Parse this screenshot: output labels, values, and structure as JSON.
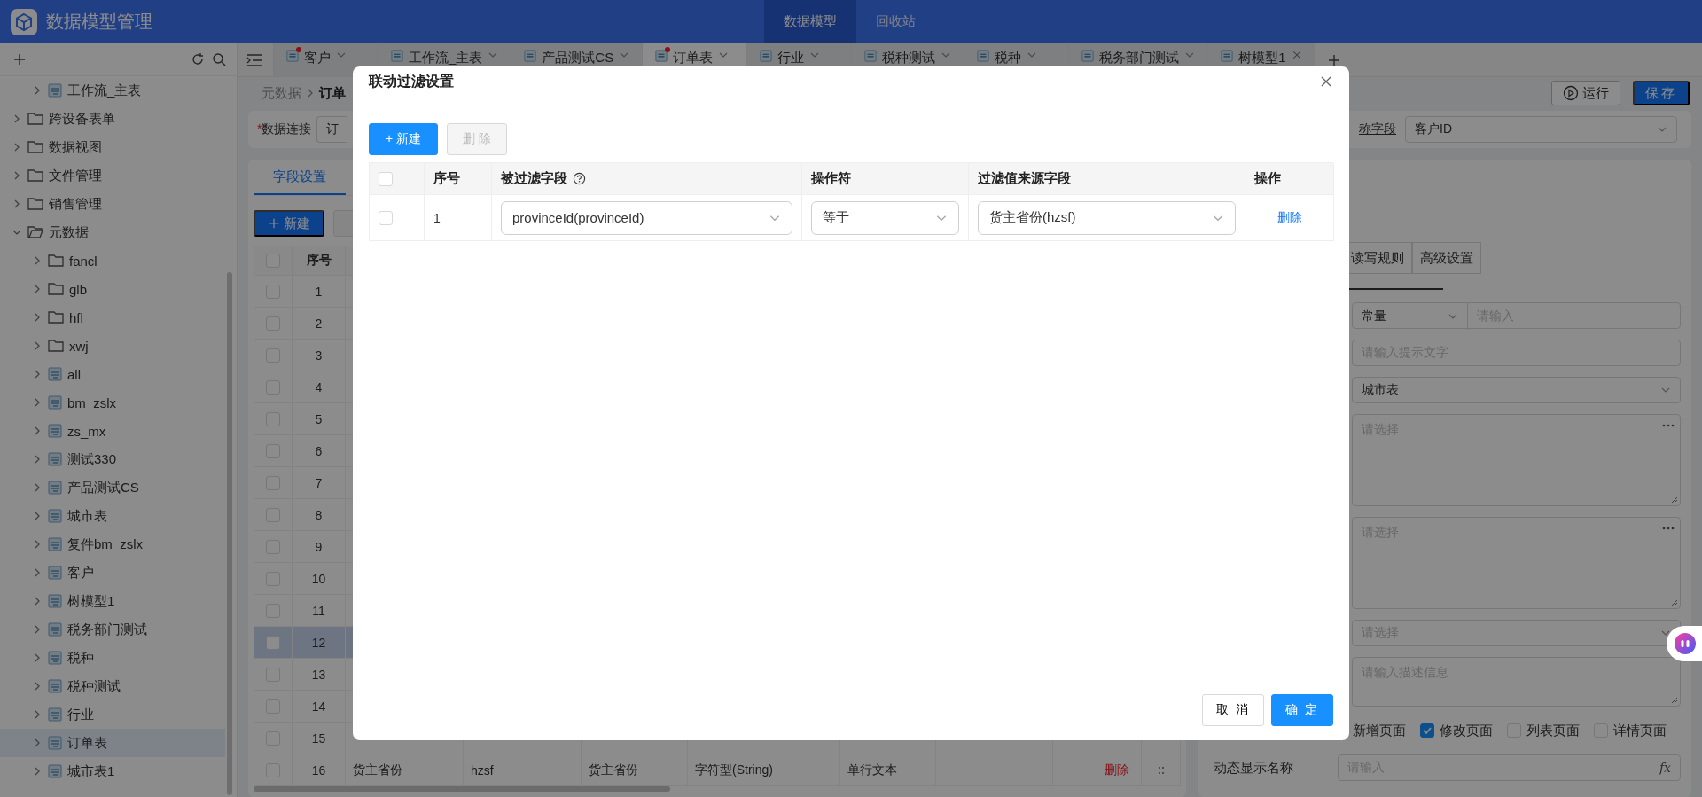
{
  "header": {
    "title": "数据模型管理",
    "nav": [
      {
        "label": "数据模型",
        "selected": true
      },
      {
        "label": "回收站",
        "selected": false
      }
    ]
  },
  "sidebar": {
    "tree_continued": [
      {
        "kind": "table",
        "label": "工作流_主表",
        "selected": false
      }
    ],
    "tree": [
      {
        "kind": "folder",
        "label": "跨设备表单",
        "expanded": false,
        "selected": false
      },
      {
        "kind": "folder",
        "label": "数据视图",
        "expanded": false,
        "selected": false
      },
      {
        "kind": "folder",
        "label": "文件管理",
        "expanded": false,
        "selected": false
      },
      {
        "kind": "folder",
        "label": "销售管理",
        "expanded": false,
        "selected": false
      },
      {
        "kind": "folder",
        "label": "元数据",
        "expanded": true,
        "selected": false,
        "children": [
          {
            "kind": "folder",
            "label": "fancl",
            "expanded": false,
            "selected": false
          },
          {
            "kind": "folder",
            "label": "glb",
            "expanded": false,
            "selected": false
          },
          {
            "kind": "folder",
            "label": "hfl",
            "expanded": false,
            "selected": false
          },
          {
            "kind": "folder",
            "label": "xwj",
            "expanded": false,
            "selected": false
          },
          {
            "kind": "table",
            "label": "all",
            "selected": false
          },
          {
            "kind": "table",
            "label": "bm_zslx",
            "selected": false
          },
          {
            "kind": "table",
            "label": "zs_mx",
            "selected": false
          },
          {
            "kind": "table",
            "label": "测试330",
            "selected": false
          },
          {
            "kind": "table",
            "label": "产品测试CS",
            "selected": false
          },
          {
            "kind": "table",
            "label": "城市表",
            "selected": false
          },
          {
            "kind": "table",
            "label": "复件bm_zslx",
            "selected": false
          },
          {
            "kind": "table",
            "label": "客户",
            "selected": false
          },
          {
            "kind": "table",
            "label": "树模型1",
            "selected": false
          },
          {
            "kind": "table",
            "label": "税务部门测试",
            "selected": false
          },
          {
            "kind": "table",
            "label": "税种",
            "selected": false
          },
          {
            "kind": "table",
            "label": "税种测试",
            "selected": false
          },
          {
            "kind": "table",
            "label": "行业",
            "selected": false
          },
          {
            "kind": "table",
            "label": "订单表",
            "selected": true
          },
          {
            "kind": "table",
            "label": "城市表1",
            "selected": false
          }
        ]
      }
    ]
  },
  "tabs": [
    {
      "label": "客户",
      "modified": true,
      "selected": false,
      "closable": false
    },
    {
      "label": "工作流_主表",
      "modified": false,
      "selected": false,
      "closable": false
    },
    {
      "label": "产品测试CS",
      "modified": false,
      "selected": false,
      "closable": false
    },
    {
      "label": "订单表",
      "modified": true,
      "selected": true,
      "closable": false
    },
    {
      "label": "行业",
      "modified": false,
      "selected": false,
      "closable": false
    },
    {
      "label": "税种测试",
      "modified": false,
      "selected": false,
      "closable": false
    },
    {
      "label": "税种",
      "modified": false,
      "selected": false,
      "closable": false
    },
    {
      "label": "税务部门测试",
      "modified": false,
      "selected": false,
      "closable": false
    },
    {
      "label": "树模型1",
      "modified": false,
      "selected": false,
      "closable": true
    }
  ],
  "breadcrumb": [
    "元数据",
    "订单"
  ],
  "run_button": "运行",
  "save_button": "保存",
  "connection": {
    "required_mark": "*",
    "label": "数据连接",
    "value": "订"
  },
  "display_field": {
    "label": "称字段",
    "value": "客户ID"
  },
  "section_tabs": [
    {
      "label": "字段设置",
      "selected": true
    }
  ],
  "new_button": "新建",
  "table": {
    "all_checked": false,
    "columns": [
      "序号"
    ],
    "rows": [
      {
        "no": "1",
        "checked": false,
        "selected": false
      },
      {
        "no": "2",
        "checked": false,
        "selected": false
      },
      {
        "no": "3",
        "checked": false,
        "selected": false
      },
      {
        "no": "4",
        "checked": false,
        "selected": false
      },
      {
        "no": "5",
        "checked": false,
        "selected": false
      },
      {
        "no": "6",
        "checked": false,
        "selected": false
      },
      {
        "no": "7",
        "checked": false,
        "selected": false
      },
      {
        "no": "8",
        "checked": false,
        "selected": false
      },
      {
        "no": "9",
        "checked": false,
        "selected": false
      },
      {
        "no": "10",
        "checked": false,
        "selected": false
      },
      {
        "no": "11",
        "checked": false,
        "selected": false
      },
      {
        "no": "12",
        "checked": false,
        "selected": true
      },
      {
        "no": "13",
        "checked": false,
        "selected": false
      },
      {
        "no": "14",
        "checked": false,
        "selected": false
      },
      {
        "no": "15",
        "checked": false,
        "selected": false
      },
      {
        "no": "16",
        "checked": false,
        "selected": false,
        "cells": [
          "货主省份",
          "hzsf",
          "货主省份",
          "字符型(String)",
          "单行文本"
        ],
        "action": "删除"
      }
    ]
  },
  "panel_tabs": [
    "读写规则",
    "高级设置"
  ],
  "form": [
    {
      "kind": "select-input",
      "value": "常量",
      "placeholder": "请输入"
    },
    {
      "kind": "input",
      "placeholder": "请输入提示文字"
    },
    {
      "kind": "select",
      "value": "城市表"
    },
    {
      "kind": "picker",
      "placeholder": "请选择"
    },
    {
      "kind": "picker",
      "placeholder": "请选择"
    },
    {
      "kind": "select",
      "placeholder": "请选择"
    },
    {
      "kind": "textarea",
      "placeholder": "请输入描述信息"
    }
  ],
  "pages": {
    "lead": "新增页面",
    "options": [
      {
        "label": "修改页面",
        "checked": true
      },
      {
        "label": "列表页面",
        "checked": false
      },
      {
        "label": "详情页面",
        "checked": false
      }
    ]
  },
  "dynamic_name": {
    "label": "动态显示名称",
    "placeholder": "请输入",
    "suffix": "fx"
  },
  "dialog": {
    "title": "联动过滤设置",
    "new_button": "+ 新建",
    "delete_button": {
      "label": "删 除",
      "disabled": true
    },
    "all_checked": false,
    "columns": [
      {
        "label": "序号",
        "help": false
      },
      {
        "label": "被过滤字段",
        "help": true
      },
      {
        "label": "操作符",
        "help": false
      },
      {
        "label": "过滤值来源字段",
        "help": false
      },
      {
        "label": "操作",
        "help": false
      }
    ],
    "rows": [
      {
        "checked": false,
        "no": "1",
        "field": "provinceId(provinceId)",
        "operator": "等于",
        "source": "货主省份(hzsf)",
        "action": "删除"
      }
    ],
    "cancel": "取 消",
    "confirm": "确 定"
  }
}
